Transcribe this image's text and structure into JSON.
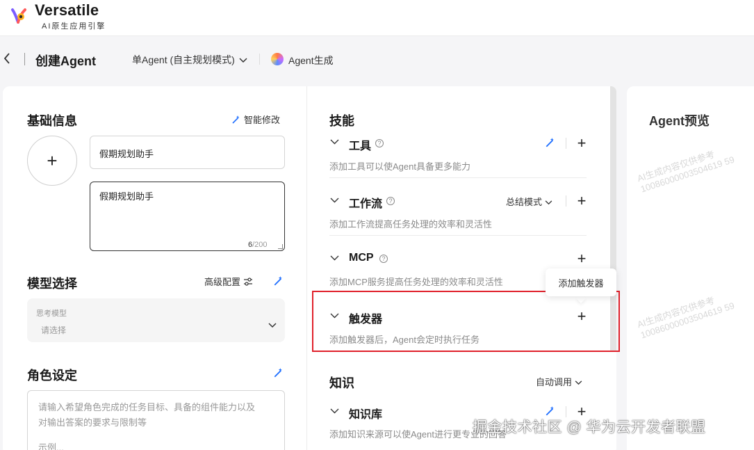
{
  "brand": {
    "name": "Versatile",
    "subtitle": "AI原生应用引擎"
  },
  "header": {
    "back_icon": "chevron-left-icon",
    "title": "创建Agent",
    "mode_select": "单Agent (自主规划模式)",
    "generate_label": "Agent生成"
  },
  "basic_info": {
    "title": "基础信息",
    "smart_edit_label": "智能修改",
    "avatar_add": "+",
    "name_value": "假期规划助手",
    "description_value": "假期规划助手",
    "char_count": "6",
    "char_limit": "/200"
  },
  "model": {
    "title": "模型选择",
    "advanced_label": "高级配置",
    "field_label": "思考模型",
    "placeholder": "请选择"
  },
  "role": {
    "title": "角色设定",
    "placeholder_line1": "请输入希望角色完成的任务目标、具备的组件能力以及",
    "placeholder_line2": "对输出答案的要求与限制等",
    "placeholder_line3": "示例..."
  },
  "skills": {
    "title": "技能",
    "tools": {
      "title": "工具",
      "desc": "添加工具可以使Agent具备更多能力"
    },
    "workflow": {
      "title": "工作流",
      "mode": "总结模式",
      "desc": "添加工作流提高任务处理的效率和灵活性"
    },
    "mcp": {
      "title": "MCP",
      "desc": "添加MCP服务提高任务处理的效率和灵活性"
    },
    "trigger": {
      "title": "触发器",
      "desc": "添加触发器后，Agent会定时执行任务",
      "tooltip": "添加触发器"
    }
  },
  "knowledge": {
    "title": "知识",
    "mode": "自动调用",
    "kb": {
      "title": "知识库",
      "desc": "添加知识来源可以使Agent进行更专业的回答"
    }
  },
  "preview": {
    "title": "Agent预览",
    "watermark_line1": "AI生成内容仅供参考",
    "watermark_line2": "10086000003504619 59"
  },
  "footer_watermark": "掘金技术社区 @ 华为云开发者联盟",
  "colors": {
    "accent": "#1f6fff",
    "highlight": "#e0202a"
  }
}
